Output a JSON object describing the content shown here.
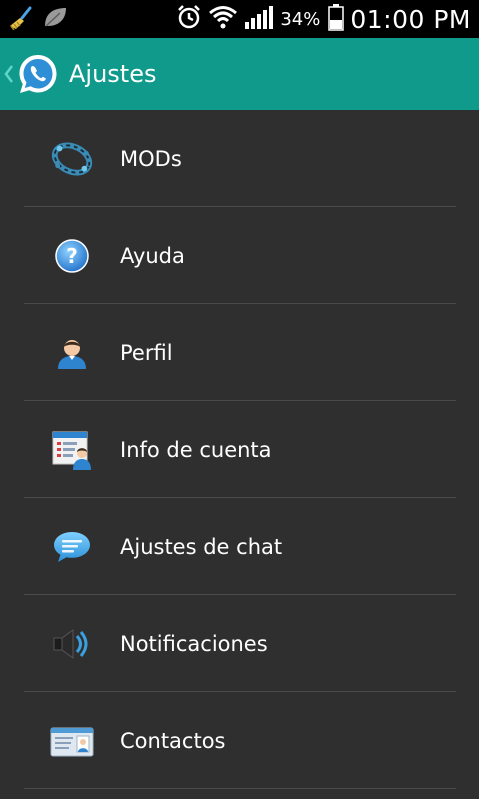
{
  "status_bar": {
    "icons_left": [
      "broom-icon",
      "leaf-icon"
    ],
    "icons_right": [
      "alarm-icon",
      "wifi-icon",
      "signal-icon",
      "battery-icon"
    ],
    "battery": "34%",
    "time": "01:00 PM"
  },
  "action_bar": {
    "title": "Ajustes",
    "background": "#0f9a8b"
  },
  "settings": {
    "items": [
      {
        "label": "MODs",
        "icon": "mods-icon"
      },
      {
        "label": "Ayuda",
        "icon": "help-icon"
      },
      {
        "label": "Perfil",
        "icon": "profile-icon"
      },
      {
        "label": "Info de cuenta",
        "icon": "account-info-icon"
      },
      {
        "label": "Ajustes de chat",
        "icon": "chat-bubble-icon"
      },
      {
        "label": "Notificaciones",
        "icon": "speaker-icon"
      },
      {
        "label": "Contactos",
        "icon": "contacts-card-icon"
      }
    ]
  }
}
